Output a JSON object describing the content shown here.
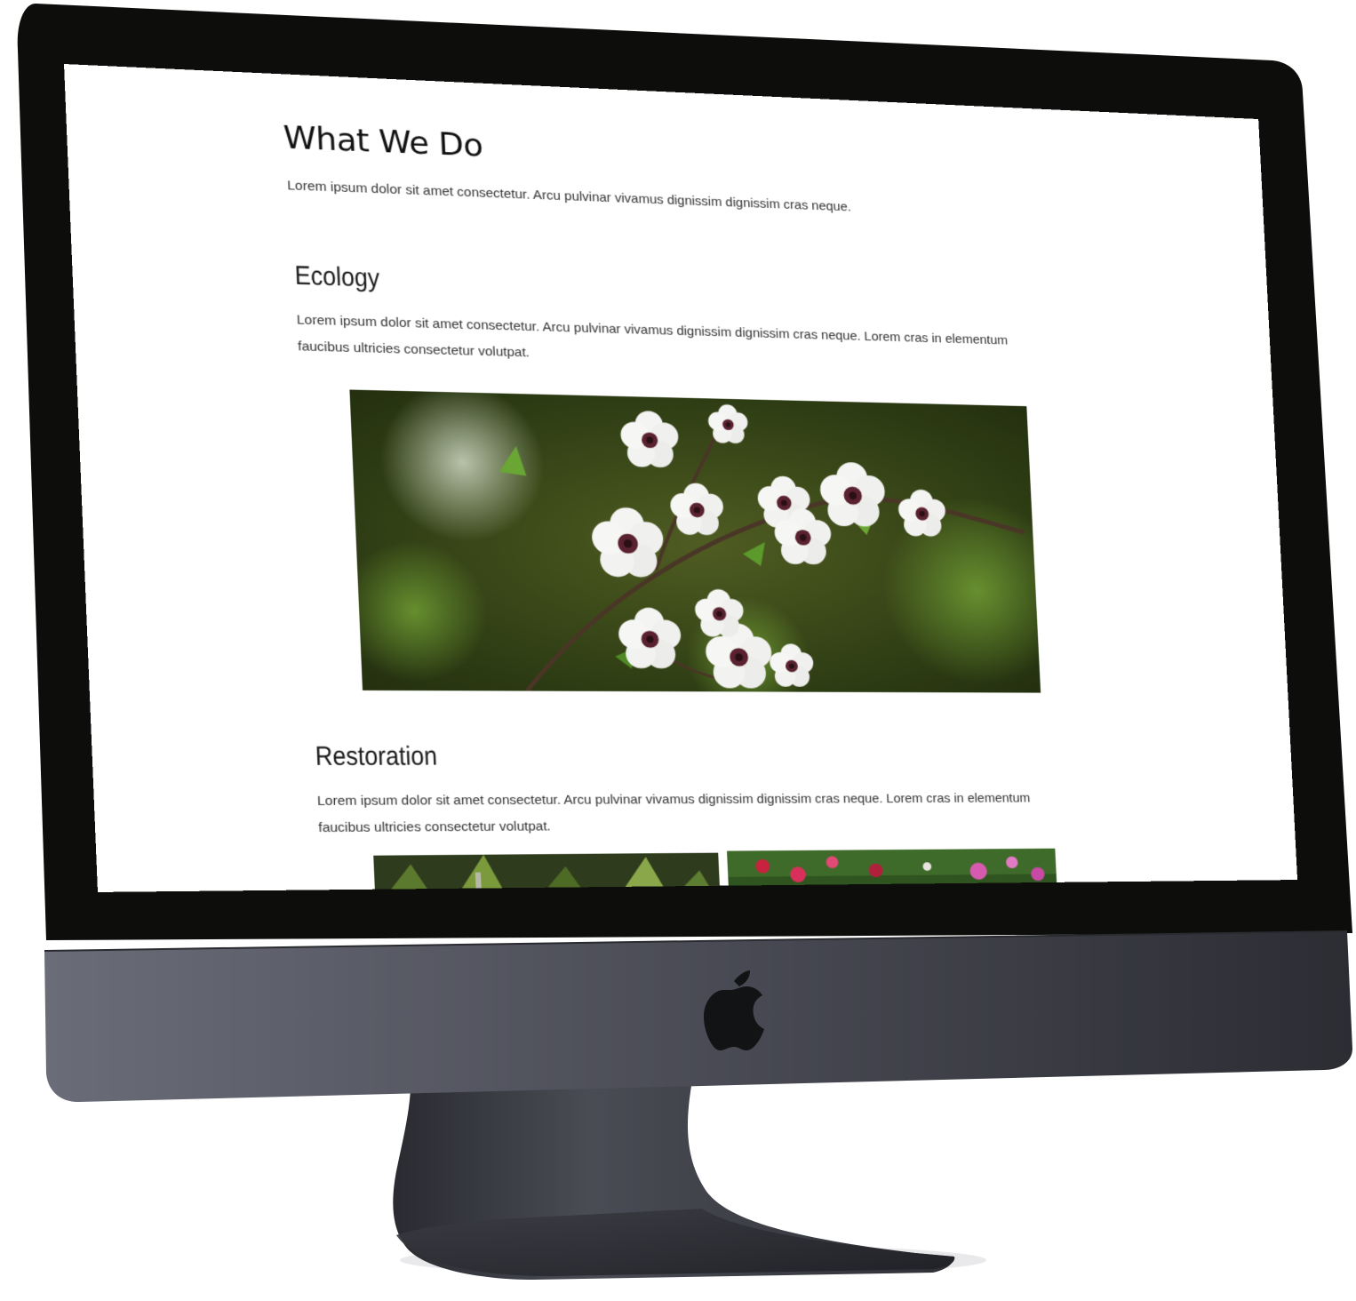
{
  "page": {
    "title": "What We Do",
    "intro": "Lorem ipsum dolor sit amet consectetur. Arcu pulvinar vivamus dignissim dignissim cras neque."
  },
  "sections": [
    {
      "heading": "Ecology",
      "body": "Lorem ipsum dolor sit amet consectetur. Arcu pulvinar vivamus dignissim dignissim cras neque. Lorem cras in elementum faucibus ultricies consectetur volutpat."
    },
    {
      "heading": "Restoration",
      "body": "Lorem ipsum dolor sit amet consectetur. Arcu pulvinar vivamus dignissim dignissim cras neque. Lorem cras in elementum faucibus ultricies consectetur volutpat."
    }
  ],
  "images": {
    "ecology_photo": "flower-blossom-photo",
    "restoration_photo_left": "fern-foliage-photo",
    "restoration_photo_right": "garden-flowers-photo"
  },
  "device": {
    "logo": "apple-logo-icon",
    "bezel_color": "#0d0e0c",
    "chin_color": "#4a4b55",
    "stand_color": "#3a3b42"
  }
}
